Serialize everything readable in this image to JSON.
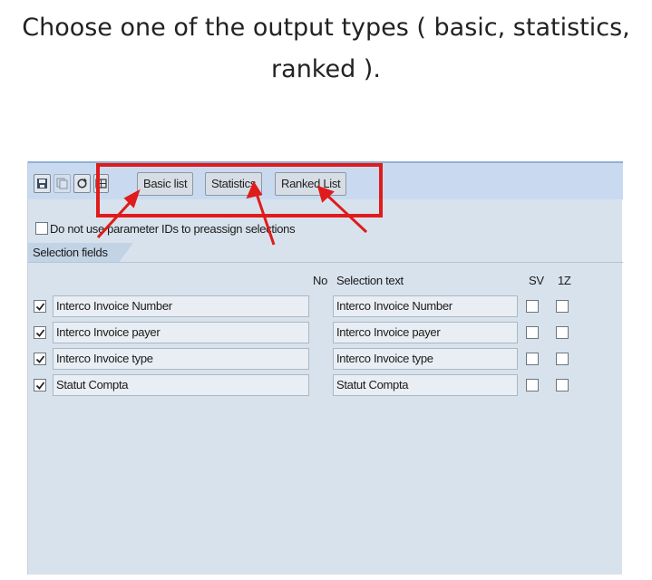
{
  "caption": {
    "line1": "Choose one of the output types ( basic, statistics,",
    "line2": "ranked )."
  },
  "toolbar": {
    "icons": [
      "save-icon",
      "copy-icon",
      "refresh-icon",
      "grid-icon"
    ],
    "buttons": [
      {
        "id": "basic",
        "label": "Basic list"
      },
      {
        "id": "statistics",
        "label": "Statistics"
      },
      {
        "id": "ranked",
        "label": "Ranked List"
      }
    ]
  },
  "param_option": {
    "label": "Do not use parameter IDs to preassign selections",
    "checked": false
  },
  "selection": {
    "tab_label": "Selection fields",
    "col_no": "No",
    "col_text": "Selection text",
    "col_sv": "SV",
    "col_1z": "1Z",
    "rows": [
      {
        "field": "Interco Invoice Number",
        "text": "Interco Invoice Number",
        "checked": true,
        "sv": false,
        "z1": false
      },
      {
        "field": "Interco Invoice payer",
        "text": "Interco Invoice payer",
        "checked": true,
        "sv": false,
        "z1": false
      },
      {
        "field": "Interco Invoice type",
        "text": "Interco Invoice type",
        "checked": true,
        "sv": false,
        "z1": false
      },
      {
        "field": "Statut Compta",
        "text": "Statut Compta",
        "checked": true,
        "sv": false,
        "z1": false
      }
    ]
  },
  "colors": {
    "highlight": "#e01b1b",
    "toolbar_bg": "#c9daf0",
    "panel_bg": "#d8e2ec"
  }
}
